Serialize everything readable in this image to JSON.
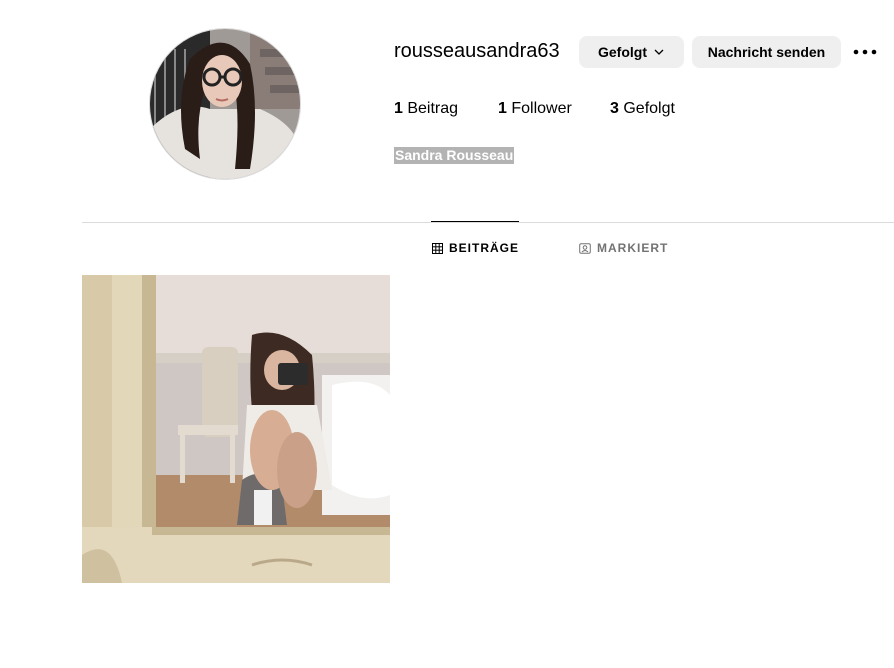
{
  "profile": {
    "username": "rousseausandra63",
    "full_name": "Sandra Rousseau",
    "follow_button": "Gefolgt",
    "message_button": "Nachricht senden",
    "more_icon": "more-horizontal-icon",
    "stats": {
      "posts_count": "1",
      "posts_label": "Beitrag",
      "followers_count": "1",
      "followers_label": "Follower",
      "following_count": "3",
      "following_label": "Gefolgt"
    }
  },
  "tabs": [
    {
      "label": "BEITRÄGE",
      "icon": "grid-icon",
      "active": true
    },
    {
      "label": "MARKIERT",
      "icon": "tagged-icon",
      "active": false
    }
  ],
  "posts": [
    {
      "type": "photo"
    }
  ],
  "colors": {
    "button_bg": "#efefef",
    "divider": "#dbdbdb",
    "inactive_tab": "#737373",
    "name_highlight": "#b3b3b3"
  }
}
